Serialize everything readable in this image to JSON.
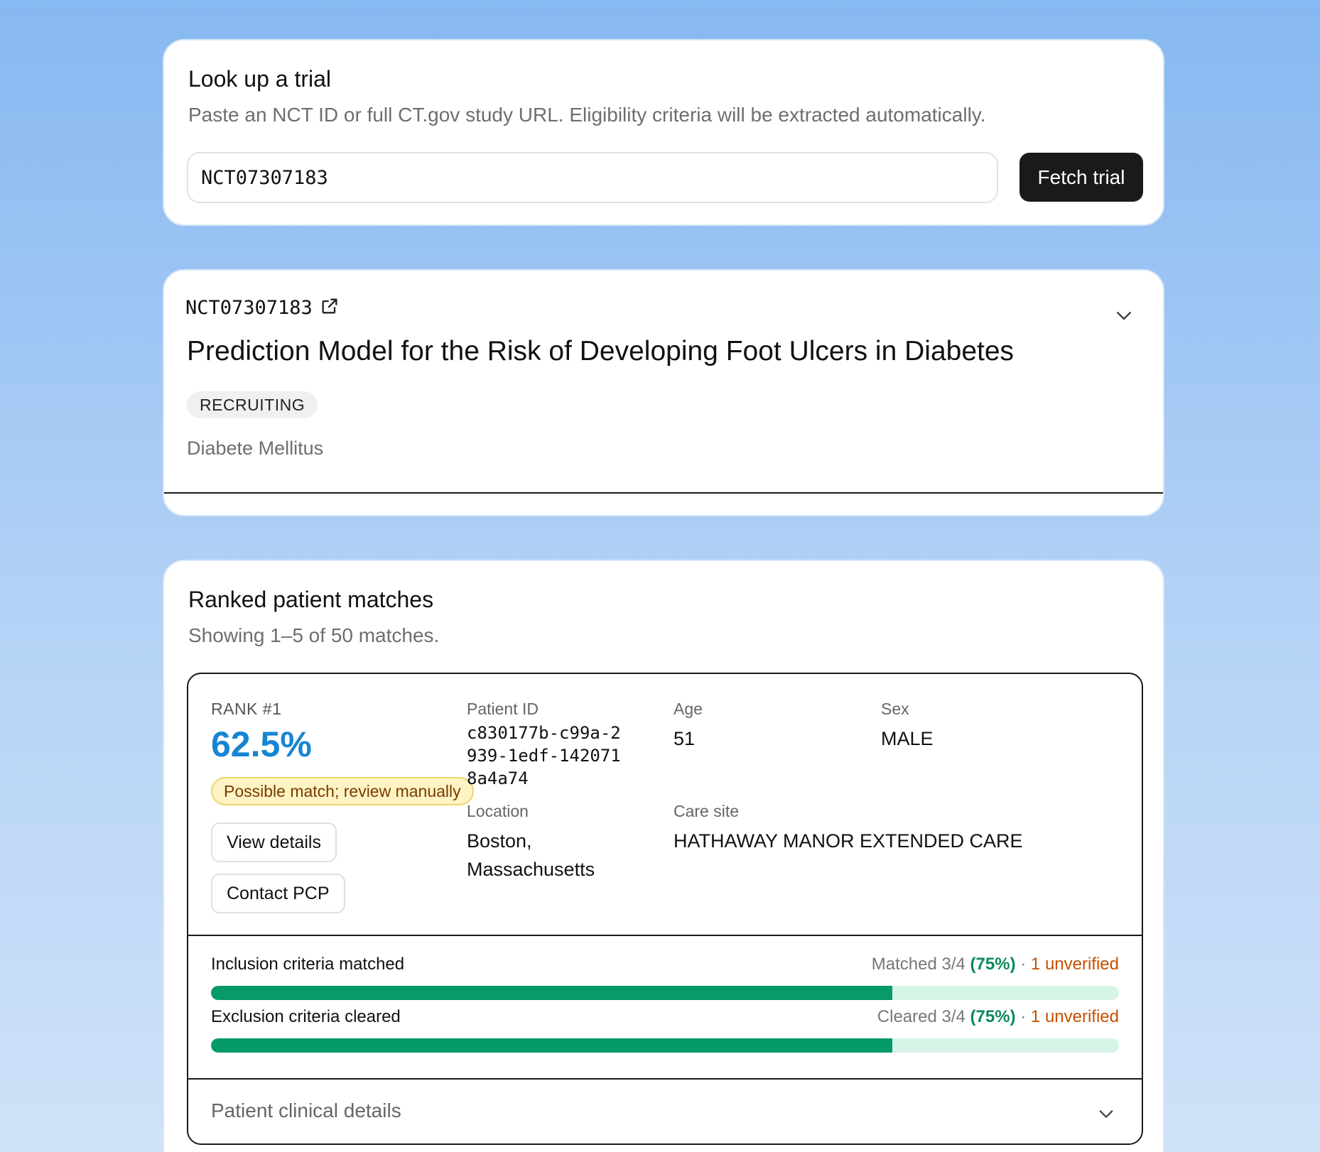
{
  "lookup": {
    "title": "Look up a trial",
    "subtitle": "Paste an NCT ID or full CT.gov study URL. Eligibility criteria will be extracted automatically.",
    "input_value": "NCT07307183",
    "fetch_label": "Fetch trial"
  },
  "trial": {
    "id": "NCT07307183",
    "title": "Prediction Model for the Risk of Developing Foot Ulcers in Diabetes",
    "status": "RECRUITING",
    "condition": "Diabete Mellitus",
    "icons": {
      "external": "external-link-icon",
      "collapse": "chevron-down-icon"
    }
  },
  "matches": {
    "title": "Ranked patient matches",
    "subtitle": "Showing 1–5 of 50 matches.",
    "results": [
      {
        "rank_label": "RANK #1",
        "score": "62.5%",
        "badge": "Possible match; review manually",
        "view_label": "View details",
        "contact_label": "Contact PCP",
        "patient_id_label": "Patient ID",
        "patient_id": "c830177b-c99a-2939-1edf-1420718a4a74",
        "age_label": "Age",
        "age": "51",
        "sex_label": "Sex",
        "sex": "MALE",
        "location_label": "Location",
        "location": "Boston, Massachusetts",
        "care_site_label": "Care site",
        "care_site": "HATHAWAY MANOR EXTENDED CARE",
        "inclusion": {
          "label": "Inclusion criteria matched",
          "summary_prefix": "Matched 3/4",
          "pct": "(75%)",
          "sep": "·",
          "unverified": "1 unverified",
          "fraction": 0.75
        },
        "exclusion": {
          "label": "Exclusion criteria cleared",
          "summary_prefix": "Cleared 3/4",
          "pct": "(75%)",
          "sep": "·",
          "unverified": "1 unverified",
          "fraction": 0.75
        },
        "clinical_label": "Patient clinical details"
      }
    ]
  },
  "colors": {
    "score": "#1785d3",
    "bar_fill": "#06996a",
    "bar_track": "#d6f5e6",
    "pct": "#0b8a5a",
    "unverified": "#c55000",
    "badge_bg": "#fdf3c4"
  }
}
